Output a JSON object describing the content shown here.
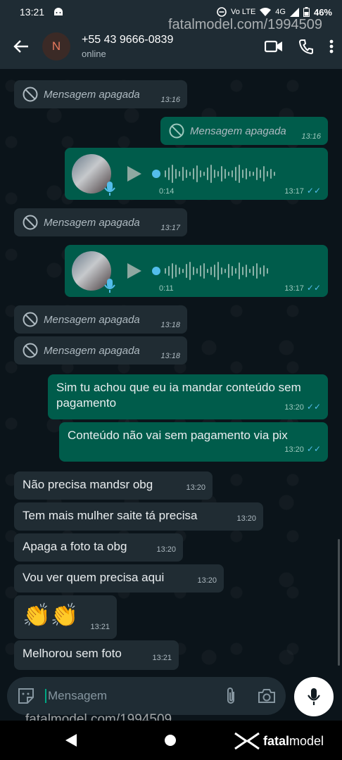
{
  "status_bar": {
    "time": "13:21",
    "network": "Vo LTE",
    "signal": "4G",
    "battery": "46%"
  },
  "header": {
    "contact_name": "+55 43 9666-0839",
    "contact_status": "online",
    "avatar_initial": "N"
  },
  "watermark": {
    "top": "fatalmodel.com/1994509",
    "bottom": "fatalmodel.com/1994509",
    "brand_left": "fatal",
    "brand_right": "model"
  },
  "messages": [
    {
      "type": "deleted",
      "dir": "in",
      "text": "Mensagem apagada",
      "time": "13:16"
    },
    {
      "type": "deleted",
      "dir": "out",
      "text": "Mensagem apagada",
      "time": "13:16"
    },
    {
      "type": "voice",
      "dir": "out",
      "duration": "0:14",
      "time": "13:17",
      "ticks": "✓✓"
    },
    {
      "type": "deleted",
      "dir": "in",
      "text": "Mensagem apagada",
      "time": "13:17"
    },
    {
      "type": "voice",
      "dir": "out",
      "duration": "0:11",
      "time": "13:17",
      "ticks": "✓✓"
    },
    {
      "type": "deleted",
      "dir": "in",
      "text": "Mensagem apagada",
      "time": "13:18"
    },
    {
      "type": "deleted",
      "dir": "in",
      "text": "Mensagem apagada",
      "time": "13:18"
    },
    {
      "type": "text",
      "dir": "out",
      "text": "Sim tu achou que eu ia mandar conteúdo sem pagamento",
      "time": "13:20",
      "ticks": "✓✓"
    },
    {
      "type": "text",
      "dir": "out",
      "text": "Conteúdo não vai sem pagamento via pix",
      "time": "13:20",
      "ticks": "✓✓"
    },
    {
      "type": "text",
      "dir": "in",
      "text": "Não precisa mandsr obg",
      "time": "13:20"
    },
    {
      "type": "text",
      "dir": "in",
      "text": "Tem mais mulher saite tá precisa",
      "time": "13:20"
    },
    {
      "type": "text",
      "dir": "in",
      "text": "Apaga a foto ta obg",
      "time": "13:20"
    },
    {
      "type": "text",
      "dir": "in",
      "text": "Vou ver quem precisa aqui",
      "time": "13:20"
    },
    {
      "type": "text",
      "dir": "in",
      "text": "👏👏",
      "time": "13:21"
    },
    {
      "type": "text",
      "dir": "in",
      "text": "Melhorou sem foto",
      "time": "13:21"
    }
  ],
  "composer": {
    "placeholder": "Mensagem"
  },
  "colors": {
    "incoming": "#202c33",
    "outgoing": "#005c4b",
    "accent": "#00a884",
    "read_ticks": "#53bdeb"
  }
}
